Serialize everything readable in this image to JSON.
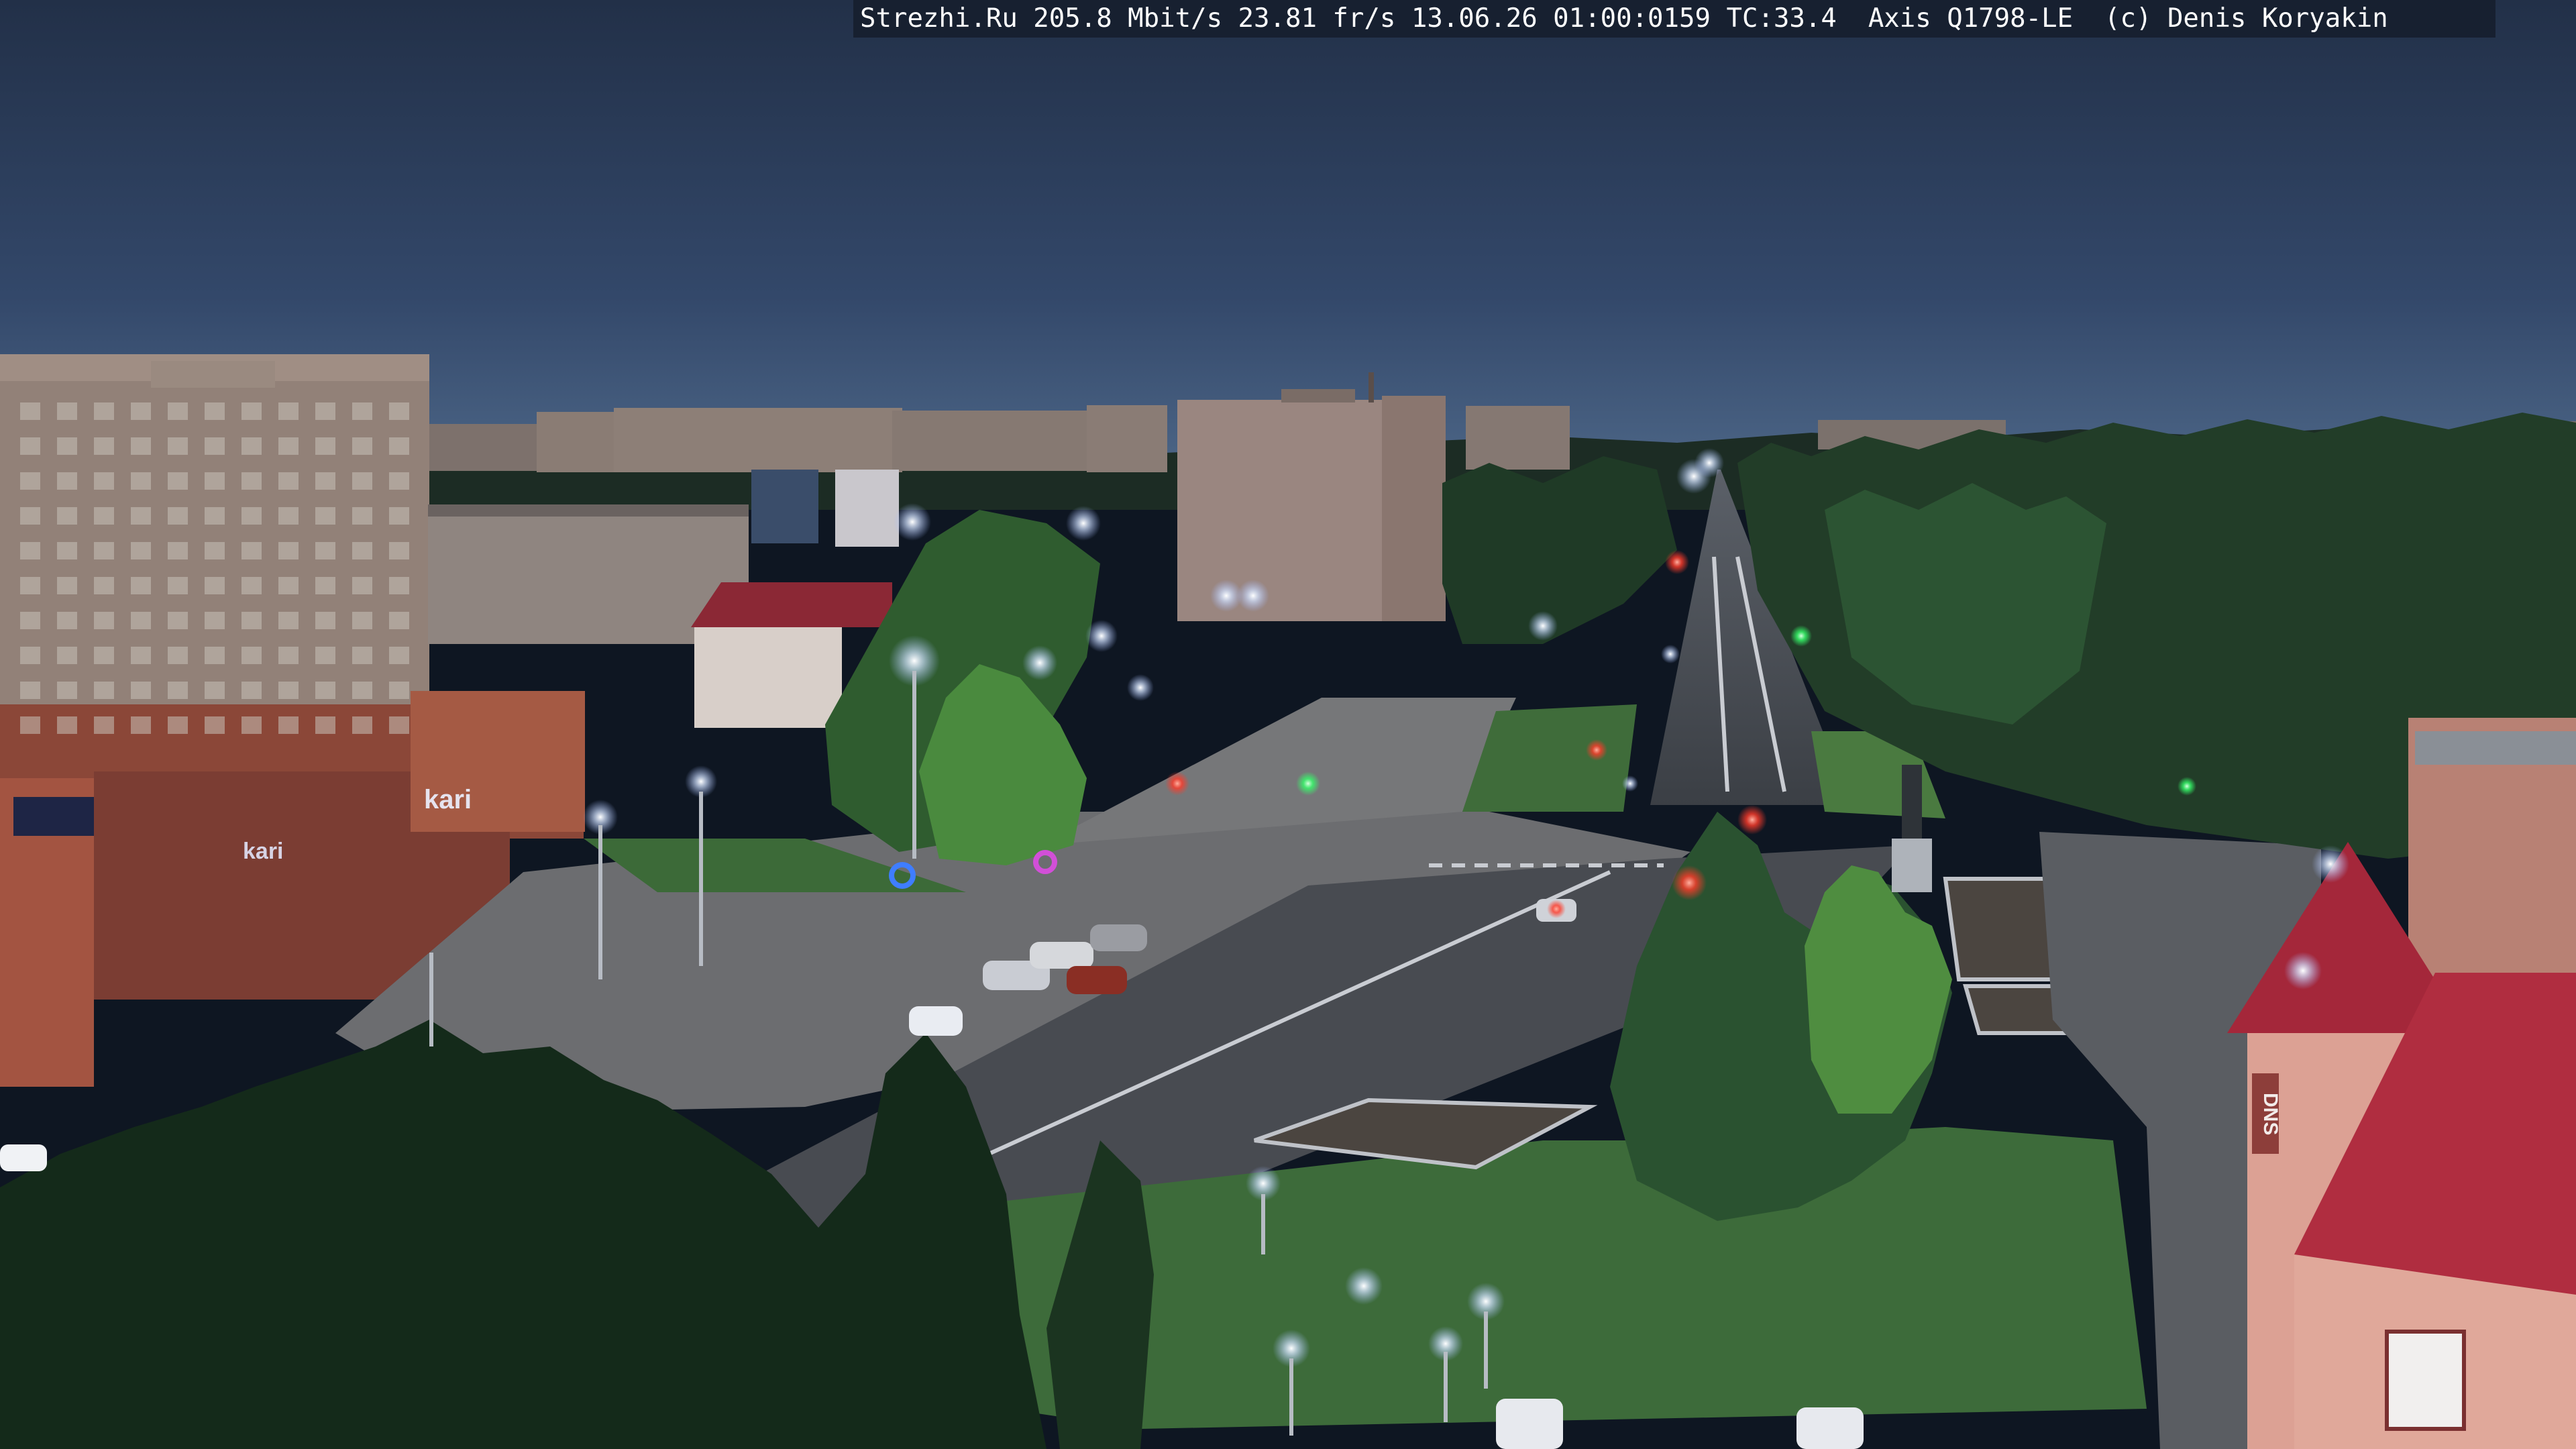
{
  "camera_overlay": {
    "site": "Strezhi.Ru",
    "bandwidth": "205.8 Mbit/s",
    "framerate": "23.81 fr/s",
    "date": "13.06.26",
    "time": "01:00:0159",
    "temperature": "TC:33.4",
    "camera_model": "Axis Q1798-LE",
    "copyright": "(c) Denis Koryakin"
  },
  "signs": {
    "store_sign": "kari",
    "store_sign_banner": "kari",
    "right_building_sign": "DNS"
  },
  "colors": {
    "sky_top": "#26344f",
    "sky_horizon": "#46607f",
    "street_light": "#dde8ff",
    "traffic_red": "#ff3b2a",
    "traffic_green": "#35ff6a",
    "roof_red": "#a4273a",
    "tree_dark": "#1c3322",
    "grass": "#3d6b3a"
  }
}
